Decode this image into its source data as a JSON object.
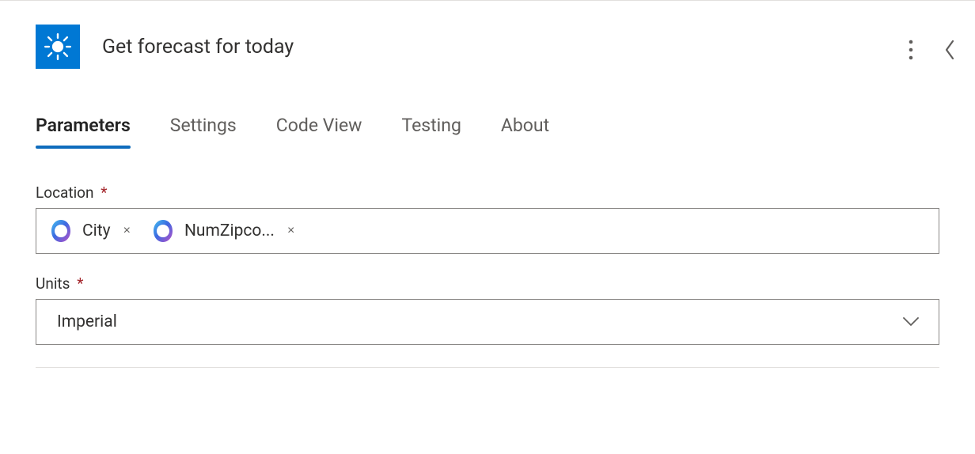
{
  "header": {
    "title": "Get forecast for today",
    "icon_name": "weather-sunny-icon"
  },
  "tabs": [
    {
      "label": "Parameters",
      "active": true
    },
    {
      "label": "Settings",
      "active": false
    },
    {
      "label": "Code View",
      "active": false
    },
    {
      "label": "Testing",
      "active": false
    },
    {
      "label": "About",
      "active": false
    }
  ],
  "fields": {
    "location": {
      "label": "Location",
      "required": true,
      "tokens": [
        {
          "label": "City"
        },
        {
          "label": "NumZipco..."
        }
      ]
    },
    "units": {
      "label": "Units",
      "required": true,
      "value": "Imperial"
    }
  },
  "glyphs": {
    "required_mark": "*",
    "token_remove": "×"
  }
}
